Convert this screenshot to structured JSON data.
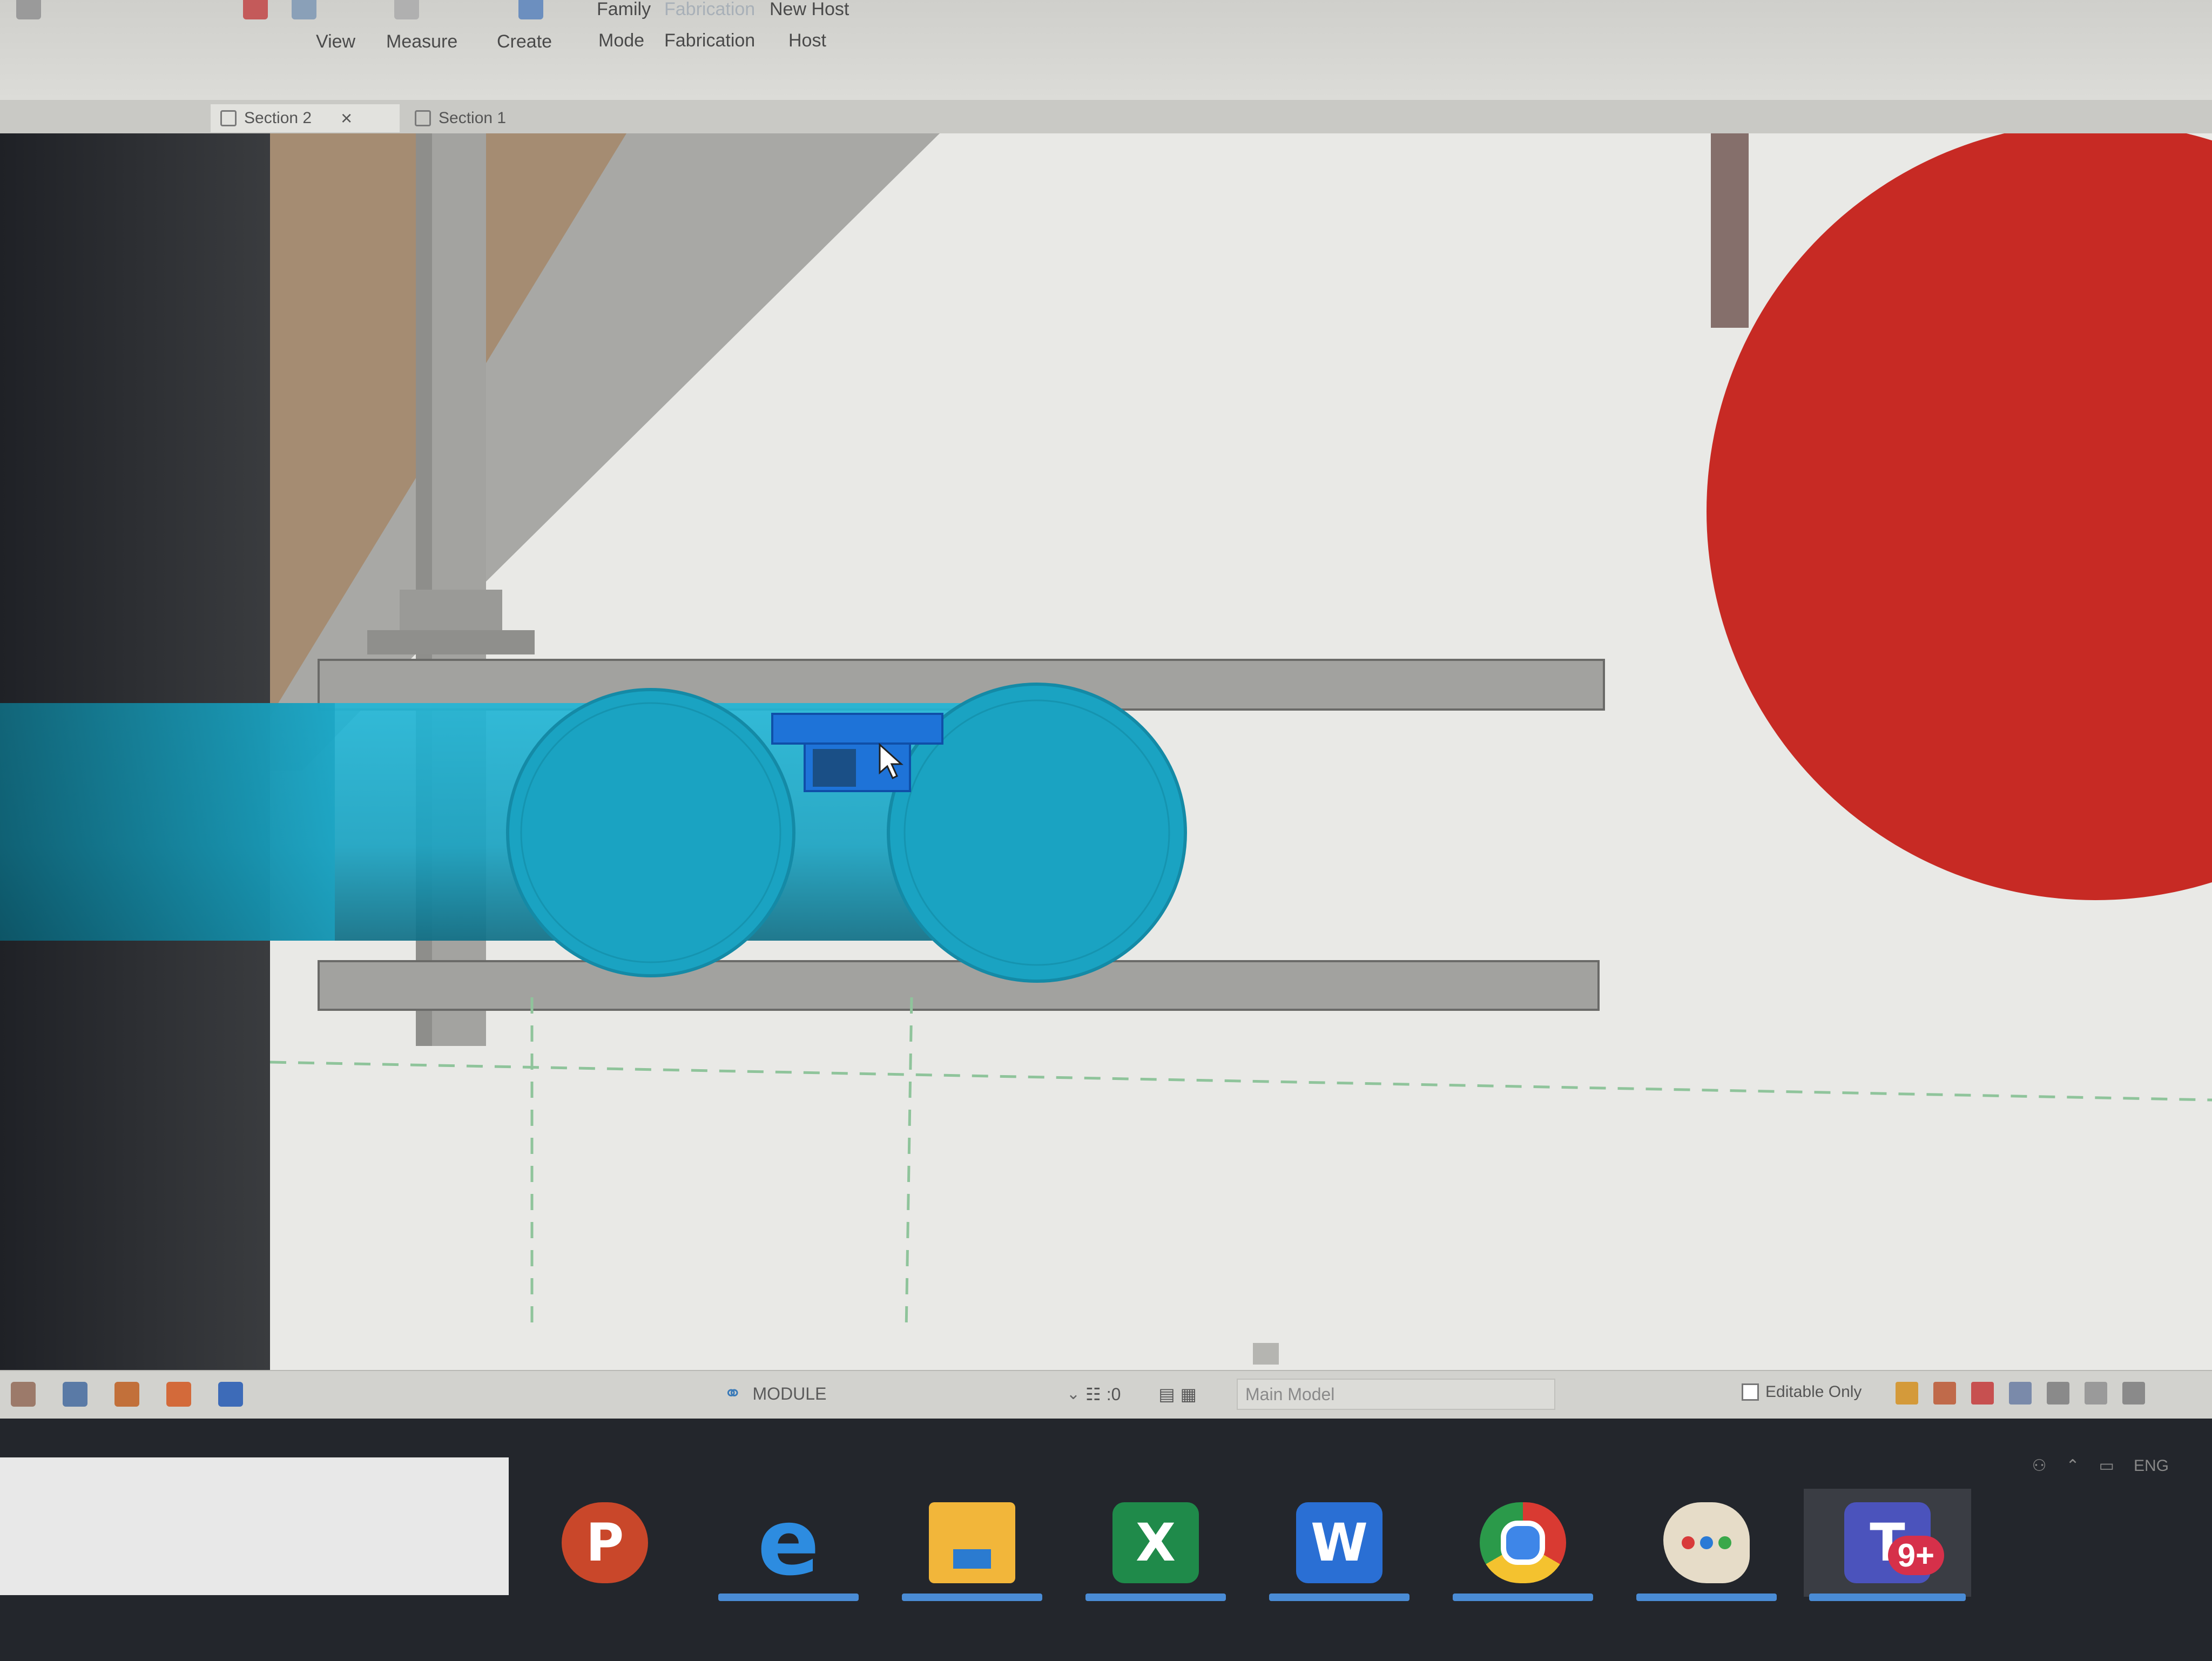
{
  "ribbon": {
    "groups": [
      {
        "label": "Family"
      },
      {
        "label": "Fabrication"
      },
      {
        "label": "New Host"
      },
      {
        "label": "View"
      },
      {
        "label": "Measure"
      },
      {
        "label": "Create"
      },
      {
        "label": "Mode"
      },
      {
        "label": "Fabrication"
      },
      {
        "label": "Host"
      }
    ]
  },
  "tabs": [
    {
      "label": "Section 2"
    },
    {
      "label": "Section 1"
    }
  ],
  "canvas": {
    "colors": {
      "pipe": "#1aa3c2",
      "selected_fitting": "#1e73d8",
      "sphere": "#d32a25",
      "beam": "#9f9f9c",
      "grid_line": "#8fc49b"
    }
  },
  "statusbar": {
    "workset": "MODULE",
    "filter_count": ":0",
    "design_option": "Main Model",
    "editable_only": "Editable Only"
  },
  "taskbar": {
    "tray_lang": "ENG",
    "teams_badge": "9+",
    "apps": [
      {
        "icon": "powerpoint-icon",
        "letter": "P"
      },
      {
        "icon": "edge-icon",
        "letter": "e"
      },
      {
        "icon": "file-explorer-icon",
        "letter": ""
      },
      {
        "icon": "excel-icon",
        "letter": "X"
      },
      {
        "icon": "word-icon",
        "letter": "W"
      },
      {
        "icon": "chrome-icon",
        "letter": ""
      },
      {
        "icon": "paint-icon",
        "letter": ""
      },
      {
        "icon": "teams-icon",
        "letter": "T"
      }
    ]
  }
}
